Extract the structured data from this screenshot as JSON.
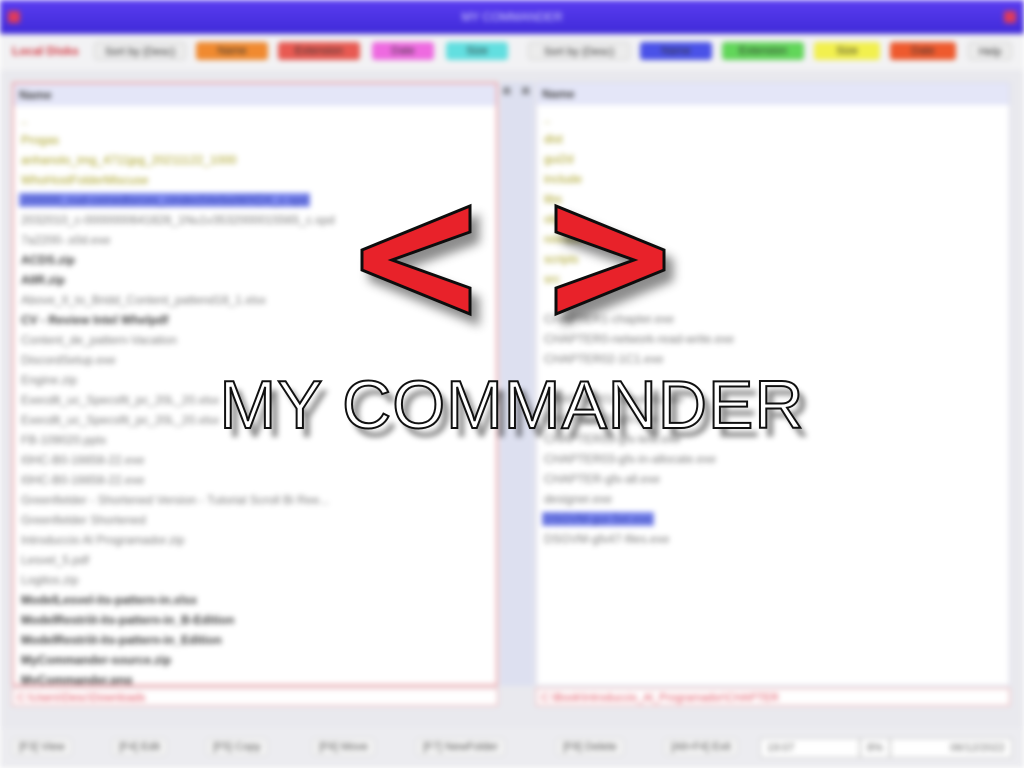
{
  "window": {
    "title": "MY COMMANDER"
  },
  "toolbar": {
    "local_disks_label": "Local Disks",
    "left_sort_label": "Sort by (Desc)",
    "left_buttons": [
      {
        "label": "Name",
        "color": "#f08a30"
      },
      {
        "label": "Extension",
        "color": "#e85a52"
      },
      {
        "label": "Date",
        "color": "#ee6ae0"
      },
      {
        "label": "Size",
        "color": "#62dfe0"
      }
    ],
    "right_sort_label": "Sort by (Desc)",
    "right_buttons": [
      {
        "label": "Name",
        "color": "#4a52e8"
      },
      {
        "label": "Extension",
        "color": "#62d65a"
      },
      {
        "label": "Size",
        "color": "#f2f04e"
      },
      {
        "label": "Date",
        "color": "#ee5a2e"
      }
    ],
    "help_label": "Help"
  },
  "left_panel": {
    "header": "Name",
    "items": [
      {
        "name": "..",
        "type": "dir"
      },
      {
        "name": "Progas",
        "type": "dir"
      },
      {
        "name": "anhanolo_img_4711jpg_20211122_1000",
        "type": "dir"
      },
      {
        "name": "WhoHostFolderMiscuse",
        "type": "dir"
      },
      {
        "name": "200000_cud-ceinedtsrces_cindectVerbsiWXDX_c.spd",
        "type": "selected"
      },
      {
        "name": "2032010_c-0000000641828_1Nu1v3532000015565_c.spd",
        "type": "file"
      },
      {
        "name": "7a2200-.s0d.exe",
        "type": "file"
      },
      {
        "name": "ACDS.zip",
        "type": "bold"
      },
      {
        "name": "AIIR.zip",
        "type": "bold"
      },
      {
        "name": "Above_II_to_Bridd_Content_pattend18_1.xlsx",
        "type": "file"
      },
      {
        "name": "CV - Review Intel Whelpdf",
        "type": "bold"
      },
      {
        "name": "Content_de_pattern-Vacation",
        "type": "file"
      },
      {
        "name": "DiscordSetup.exe",
        "type": "file"
      },
      {
        "name": "Engine.zip",
        "type": "file"
      },
      {
        "name": "Execdlt_uc_Specsfit_pc_20L_20.xlsx",
        "type": "file"
      },
      {
        "name": "Execdlt_uc_Specsfit_pc_20L_20.xlsx",
        "type": "file"
      },
      {
        "name": "FB-109020.pptx",
        "type": "file"
      },
      {
        "name": "I0HC-B0-16658-22.exe",
        "type": "file"
      },
      {
        "name": "I0HC-B0-16658-22.exe",
        "type": "file"
      },
      {
        "name": "Greenfielder - Shortened Version - Tutorial Scroll Bi Ree...",
        "type": "file"
      },
      {
        "name": "Greenfielder Shortened",
        "type": "file"
      },
      {
        "name": "Introduccio Al Programador.zip",
        "type": "file"
      },
      {
        "name": "Lesvel_5.pdf",
        "type": "file"
      },
      {
        "name": "Logitos.zip",
        "type": "file"
      },
      {
        "name": "ModelLesvel-its-pattern-in.xlsx",
        "type": "bold"
      },
      {
        "name": "ModelRestriit-its-pattern-in_B-Edition",
        "type": "bold"
      },
      {
        "name": "ModelRestriit-its-pattern-in_Edition",
        "type": "bold"
      },
      {
        "name": "MyCommander-source.zip",
        "type": "bold"
      },
      {
        "name": "MyCommander.png",
        "type": "bold"
      }
    ],
    "path": "C:\\Users\\Desc\\Downloads"
  },
  "mid_strip": {
    "left_arrow": "R",
    "right_arrow": "R"
  },
  "right_panel": {
    "header": "Name",
    "items": [
      {
        "name": "..",
        "type": "dir"
      },
      {
        "name": "dist",
        "type": "dir"
      },
      {
        "name": "gui2d",
        "type": "dir"
      },
      {
        "name": "include",
        "type": "dir"
      },
      {
        "name": "libs",
        "type": "dir"
      },
      {
        "name": "obj",
        "type": "dir"
      },
      {
        "name": "release",
        "type": "dir"
      },
      {
        "name": "scripts",
        "type": "dir"
      },
      {
        "name": "src",
        "type": "dir"
      },
      {
        "name": "",
        "type": "file"
      },
      {
        "name": "CHAPTER1-chapter.exe",
        "type": "file"
      },
      {
        "name": "CHAPTER0-network-read-write.exe",
        "type": "file"
      },
      {
        "name": "CHAPTER02-1C1.exe",
        "type": "file"
      },
      {
        "name": "",
        "type": "file"
      },
      {
        "name": "CHAPTER01-handles.exe",
        "type": "file"
      },
      {
        "name": "CHAPTER02-gfx.exe",
        "type": "file"
      },
      {
        "name": "CHAPTER03-gfx-test.exe",
        "type": "file"
      },
      {
        "name": "CHAPTER03-gfx-in-allocate.exe",
        "type": "file"
      },
      {
        "name": "CHAPTER-gfx-all.exe",
        "type": "file"
      },
      {
        "name": "designer.exe",
        "type": "file"
      },
      {
        "name": "DSGVM-gui-Sel.exe",
        "type": "selected"
      },
      {
        "name": "DSGVM-gfx47-files.exe",
        "type": "file"
      }
    ],
    "path": "C:\\Book\\Introduccio_Al_Programador\\CHAPTER"
  },
  "function_keys": [
    {
      "label": "[F3] View"
    },
    {
      "label": "[F4] Edit"
    },
    {
      "label": "[F5] Copy"
    },
    {
      "label": "[F6] Move"
    },
    {
      "label": "[F7] NewFolder"
    },
    {
      "label": "[F8] Delete"
    },
    {
      "label": "[Alt+F4] Exit"
    }
  ],
  "status": {
    "time": "19:07",
    "pct": "8%",
    "date": "06/12/2022"
  },
  "splash": {
    "title": "MY COMMANDER",
    "chevron_color": "#e8202a"
  }
}
